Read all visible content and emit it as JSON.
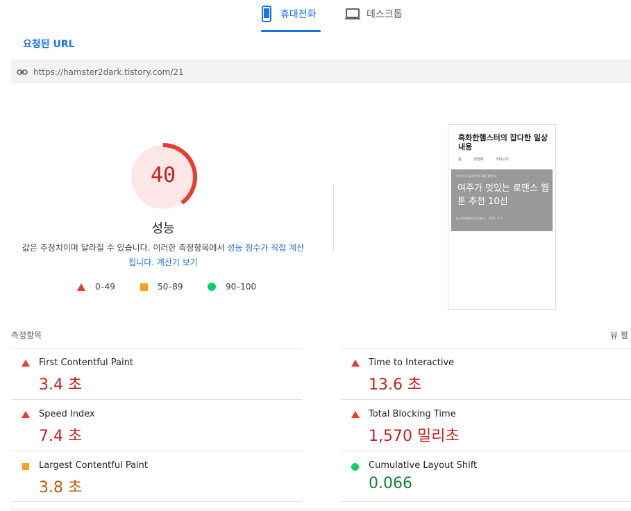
{
  "device_tabs": {
    "mobile": "휴대전화",
    "desktop": "데스크톱"
  },
  "url_section": {
    "tab_label": "요청된 URL",
    "url": "https://hamster2dark.tistory.com/21"
  },
  "performance": {
    "score": "40",
    "score_fraction": 0.4,
    "title": "성능",
    "desc_prefix": "값은 추정치이며 달라질 수 있습니다. 이러한 측정항목에서 ",
    "desc_link": "성능 점수가 직접 계산됩니다.",
    "desc_calc_link": "계산기 보기",
    "colors": {
      "fail": "#eb3b2f",
      "fail_bg": "#fde8e7",
      "average": "#f4a321",
      "pass": "#0cce6b"
    }
  },
  "legend": {
    "fail": "0–49",
    "average": "50–89",
    "pass": "90–100"
  },
  "screenshot": {
    "site_title": "흑화한햄스터의 잡다한 일상내용",
    "nav": [
      "홈",
      "방명록",
      "카테고리"
    ],
    "category": "더 피터의 알고있어요 웹툰 해설 투",
    "headline": "여주가 멋있는 로맨스 웹툰 추천 10선",
    "meta": "by 흑화한햄스터(바룸이) · 2021. 3. 6."
  },
  "metrics_section": {
    "label": "측정항목",
    "view_label": "뷰 펼"
  },
  "metrics": [
    {
      "name": "First Contentful Paint",
      "value": "3.4 초",
      "rating": "fail"
    },
    {
      "name": "Time to Interactive",
      "value": "13.6 초",
      "rating": "fail"
    },
    {
      "name": "Speed Index",
      "value": "7.4 초",
      "rating": "fail"
    },
    {
      "name": "Total Blocking Time",
      "value": "1,570 밀리초",
      "rating": "fail"
    },
    {
      "name": "Largest Contentful Paint",
      "value": "3.8 초",
      "rating": "average"
    },
    {
      "name": "Cumulative Layout Shift",
      "value": "0.066",
      "rating": "pass"
    }
  ]
}
